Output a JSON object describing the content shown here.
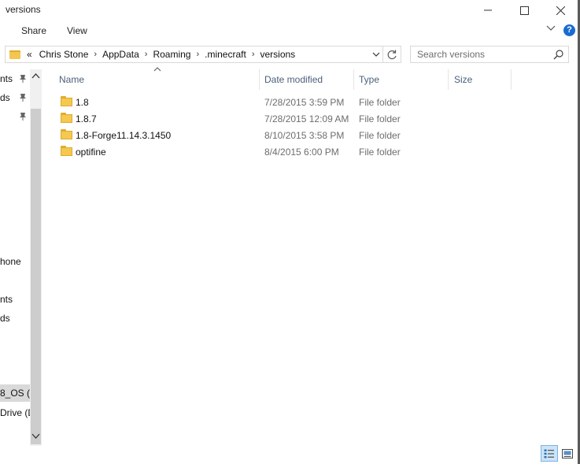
{
  "window": {
    "title": "versions",
    "minimize_icon": "minimize-icon",
    "maximize_icon": "maximize-icon",
    "close_icon": "close-icon"
  },
  "ribbon": {
    "tabs": [
      "Share",
      "View"
    ],
    "help_label": "?"
  },
  "address_bar": {
    "overflow": "«",
    "crumbs": [
      "Chris Stone",
      "AppData",
      "Roaming",
      ".minecraft",
      "versions"
    ]
  },
  "search": {
    "placeholder": "Search versions"
  },
  "nav_pane": {
    "items": [
      {
        "label": "nts",
        "pinned": true
      },
      {
        "label": "ds",
        "pinned": true
      },
      {
        "label": "",
        "pinned": true
      },
      {
        "label": "hone",
        "pinned": false
      },
      {
        "label": "nts",
        "pinned": false
      },
      {
        "label": "ds",
        "pinned": false
      },
      {
        "label": "8_OS (C",
        "pinned": false,
        "selected": true
      },
      {
        "label": "Drive (D",
        "pinned": false
      }
    ]
  },
  "columns": {
    "name": "Name",
    "date": "Date modified",
    "type": "Type",
    "size": "Size"
  },
  "files": [
    {
      "name": "1.8",
      "date": "7/28/2015 3:59 PM",
      "type": "File folder"
    },
    {
      "name": "1.8.7",
      "date": "7/28/2015 12:09 AM",
      "type": "File folder"
    },
    {
      "name": "1.8-Forge11.14.3.1450",
      "date": "8/10/2015 3:58 PM",
      "type": "File folder"
    },
    {
      "name": "optifine",
      "date": "8/4/2015 6:00 PM",
      "type": "File folder"
    }
  ],
  "colors": {
    "folder": "#f5c850",
    "header_text": "#4c607a",
    "selection": "#cce4f7",
    "help": "#1a6bd0"
  }
}
